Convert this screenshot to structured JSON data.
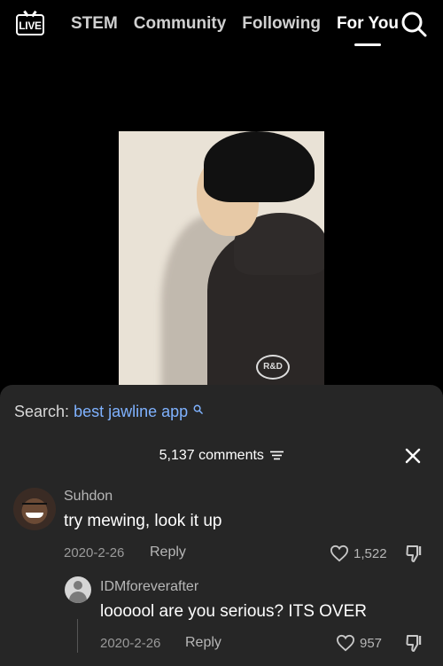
{
  "topbar": {
    "live_label": "LIVE",
    "tabs": [
      {
        "label": "STEM"
      },
      {
        "label": "Community"
      },
      {
        "label": "Following"
      },
      {
        "label": "For You"
      }
    ]
  },
  "video": {
    "hoodie_logo": "R&D"
  },
  "comments_sheet": {
    "search_prefix": "Search:",
    "search_query": "best jawline app",
    "comment_count": "5,137 comments",
    "comments": [
      {
        "username": "Suhdon",
        "text": "try mewing, look it up",
        "date": "2020-2-26",
        "reply_label": "Reply",
        "likes": "1,522"
      },
      {
        "username": "IDMforeverafter",
        "text": "loooool are you serious? ITS OVER",
        "date": "2020-2-26",
        "reply_label": "Reply",
        "likes": "957"
      }
    ]
  },
  "colors": {
    "background": "#000000",
    "sheet": "#262626",
    "link": "#7fb2ff",
    "muted": "#9a9a9a"
  },
  "icons": [
    "live-tv-icon",
    "search-icon",
    "filter-icon",
    "close-icon",
    "heart-icon",
    "dislike-icon"
  ]
}
